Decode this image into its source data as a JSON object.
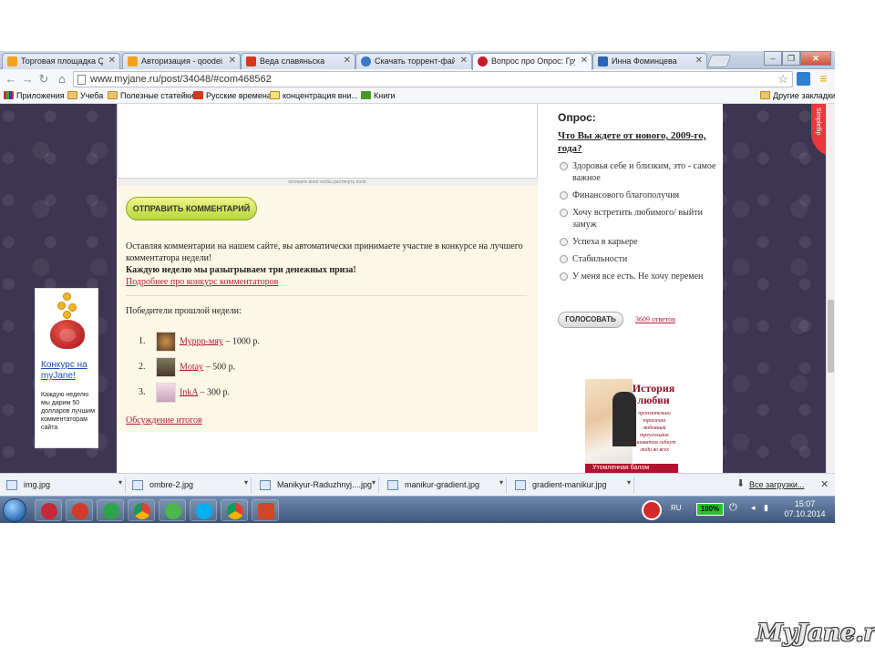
{
  "browser": {
    "tabs": [
      {
        "label": "Торговая площадка Qoo",
        "color": "#f3a21b"
      },
      {
        "label": "Авторизация - qoodei.kz",
        "color": "#f3a21b"
      },
      {
        "label": "Веда славяньска",
        "color": "#d9371e"
      },
      {
        "label": "Скачать торрент-файл Ко",
        "color": "#3a76c4"
      },
      {
        "label": "Вопрос про Опрос: Груп",
        "color": "#c91b2b"
      },
      {
        "label": "Инна Фоминцева",
        "color": "#2c65b8"
      }
    ],
    "address": "www.myjane.ru/post/34048/#com468562",
    "bookmarks": {
      "apps": "Приложения",
      "items": [
        "Учеба",
        "Полезные статейки",
        "Русские времена",
        "концентрация вни...",
        "Книги"
      ],
      "other": "Другие закладки"
    }
  },
  "page": {
    "resize_hint": "потяните вниз чтобы растянуть поле",
    "send_button": "ОТПРАВИТЬ КОММЕНТАРИЙ",
    "info_text": "Оставляя комментарии на нашем сайте, вы автоматически принимаете участие в конкурсе на лучшего комментатора недели!",
    "info_bold": "Каждую неделю мы разыгрываем три денежных приза!",
    "info_link": "Подробнее про конкурс комментаторов",
    "winners_title": "Победители прошлой недели:",
    "winners": [
      {
        "num": "1.",
        "name": "Муррр-мяу",
        "prize": "– 1000 р."
      },
      {
        "num": "2.",
        "name": "Motay",
        "prize": "– 500 р."
      },
      {
        "num": "3.",
        "name": "InkA",
        "prize": "– 300 р."
      }
    ],
    "discuss_link": "Обсуждение итогов"
  },
  "poll": {
    "heading": "Опрос:",
    "question": "Что Вы ждете от нового, 2009-го, года?",
    "options": [
      "Здоровья себе и близким, это - самое важное",
      "Финансового благополучия",
      "Хочу встретить любимого/ выйти замуж",
      "Успеха в карьере",
      "Стабильности",
      "У меня все есть. Не хочу перемен"
    ],
    "vote_button": "ГОЛОСОВАТЬ",
    "answers_link": "3609 ответов"
  },
  "story_ad": {
    "title": "История любви",
    "sub": "пронзительно трагична любовный треугольник виноватая гибнут люди во всех",
    "bar": "Утомленная балом"
  },
  "promo": {
    "title": "Конкурс на myJane!",
    "text": "Каждую неделю мы дарим 50 долларов лучшим комментаторам сайта"
  },
  "ribbon": "Simpleflip",
  "downloads": {
    "items": [
      "img.jpg",
      "ombre-2.jpg",
      "Manikyur-Raduzhnyj....jpg",
      "manikur-gradient.jpg",
      "gradient-manikur.jpg"
    ],
    "all": "Все загрузки..."
  },
  "taskbar": {
    "lang": "RU",
    "battery": "100%",
    "time": "15:07",
    "date": "07.10.2014"
  },
  "brand": "MyJane.ru"
}
